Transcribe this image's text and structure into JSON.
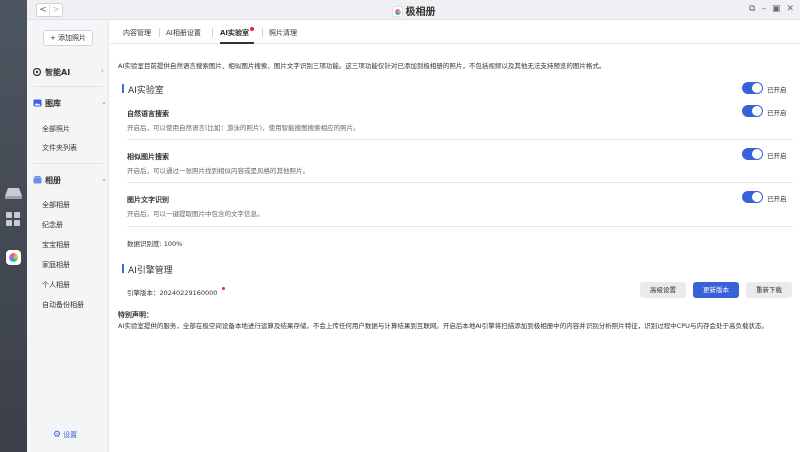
{
  "window": {
    "title": "极相册",
    "nav_back": "<",
    "nav_forward": ">",
    "controls": [
      "⧉",
      "–",
      "▣",
      "✕"
    ]
  },
  "sidebar": {
    "add_button": "+ 添加照片",
    "ai_section": "智能AI",
    "library_section": "图库",
    "library_items": [
      "全部照片",
      "文件夹列表"
    ],
    "album_section": "相册",
    "album_items": [
      "全部相册",
      "纪念册",
      "宝宝相册",
      "家庭相册",
      "个人相册",
      "自动备份相册"
    ],
    "settings": "设置"
  },
  "tabs": [
    {
      "label": "内容管理",
      "active": false
    },
    {
      "label": "AI相册设置",
      "active": false
    },
    {
      "label": "AI实验室",
      "active": true
    },
    {
      "label": "照片清理",
      "active": false
    }
  ],
  "intro": "AI实验室目前提供自然语言搜索图片、相似图片搜索、图片文字识别三项功能。这三项功能仅针对已添加到极相册的照片，不包括视频以及其他无法支持预览的图片格式。",
  "lab": {
    "title": "AI实验室",
    "status": "已开启",
    "features": [
      {
        "title": "自然语言搜索",
        "desc": "开启后，可以使用自然语言(比如：游泳的照片)，使用智能搜图搜索相应的照片。",
        "status": "已开启"
      },
      {
        "title": "相似图片搜索",
        "desc": "开启后，可以通过一张照片找到相似内容或是风格的其他照片。",
        "status": "已开启"
      },
      {
        "title": "图片文字识别",
        "desc": "开启后，可以一键提取图片中包含的文字信息。",
        "status": "已开启"
      }
    ],
    "progress": "数据识别度: 100%"
  },
  "engine": {
    "title": "AI引擎管理",
    "version": "引擎版本：20240229160000",
    "buttons": {
      "advanced": "高级设置",
      "update": "更新版本",
      "redownload": "重新下载"
    }
  },
  "declaration": {
    "title": "特别声明：",
    "text": "AI实验室提供的服务，全部在极空间设备本地进行运算及结果存储，不会上传任何用户数据与计算结果到互联网。开启后本地AI引擎将扫描添加到极相册中的内容并识别分析照片特征，识别过程中CPU与内存会处于高负载状态。"
  },
  "colors": {
    "accent": "#3a62d8",
    "dot": "#e23333"
  }
}
